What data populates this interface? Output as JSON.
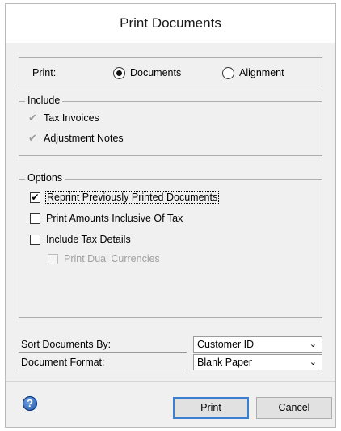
{
  "window": {
    "title": "Print Documents"
  },
  "print_row": {
    "label": "Print:",
    "options": [
      {
        "label": "Documents",
        "selected": true
      },
      {
        "label": "Alignment",
        "selected": false
      }
    ]
  },
  "include": {
    "legend": "Include",
    "items": [
      {
        "label": "Tax Invoices",
        "checked": true,
        "enabled": false
      },
      {
        "label": "Adjustment Notes",
        "checked": true,
        "enabled": false
      }
    ]
  },
  "options": {
    "legend": "Options",
    "items": [
      {
        "label": "Reprint Previously Printed Documents",
        "checked": true,
        "enabled": true,
        "focused": true
      },
      {
        "label": "Print Amounts Inclusive Of Tax",
        "checked": false,
        "enabled": true
      },
      {
        "label": "Include Tax Details",
        "checked": false,
        "enabled": true
      },
      {
        "label": "Print Dual Currencies",
        "checked": false,
        "enabled": false
      }
    ]
  },
  "fields": {
    "sort": {
      "label": "Sort Documents By:",
      "value": "Customer ID"
    },
    "format": {
      "label": "Document Format:",
      "value": "Blank Paper"
    }
  },
  "footer": {
    "help_glyph": "?",
    "print_button": {
      "pre": "Pr",
      "accel": "i",
      "post": "nt"
    },
    "cancel_button": {
      "pre": "",
      "accel": "C",
      "post": "ancel"
    }
  },
  "icons": {
    "check": "✔",
    "chevron": "⌄"
  },
  "colors": {
    "window_bg": "#f0f0f0",
    "default_button_border": "#3c7fd1"
  }
}
